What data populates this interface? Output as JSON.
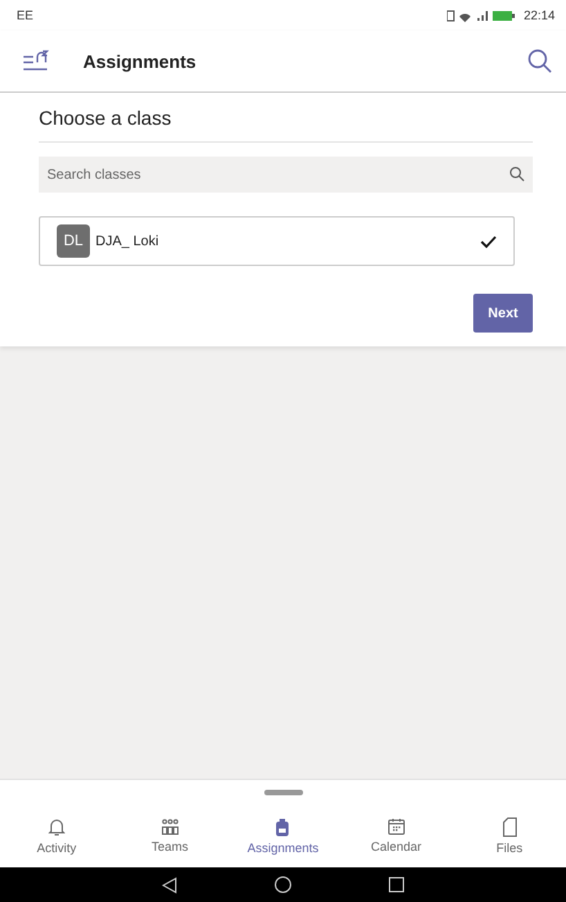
{
  "status_bar": {
    "carrier": "EE",
    "time": "22:14"
  },
  "header": {
    "title": "Assignments"
  },
  "panel": {
    "title": "Choose a class",
    "search": {
      "placeholder": "Search classes"
    },
    "classes": [
      {
        "initials": "DL",
        "name": "DJA_ Loki",
        "selected": true
      }
    ],
    "next_button": "Next"
  },
  "tabs": [
    {
      "label": "Activity",
      "selected": false
    },
    {
      "label": "Teams",
      "selected": false
    },
    {
      "label": "Assignments",
      "selected": true
    },
    {
      "label": "Calendar",
      "selected": false
    },
    {
      "label": "Files",
      "selected": false
    }
  ]
}
